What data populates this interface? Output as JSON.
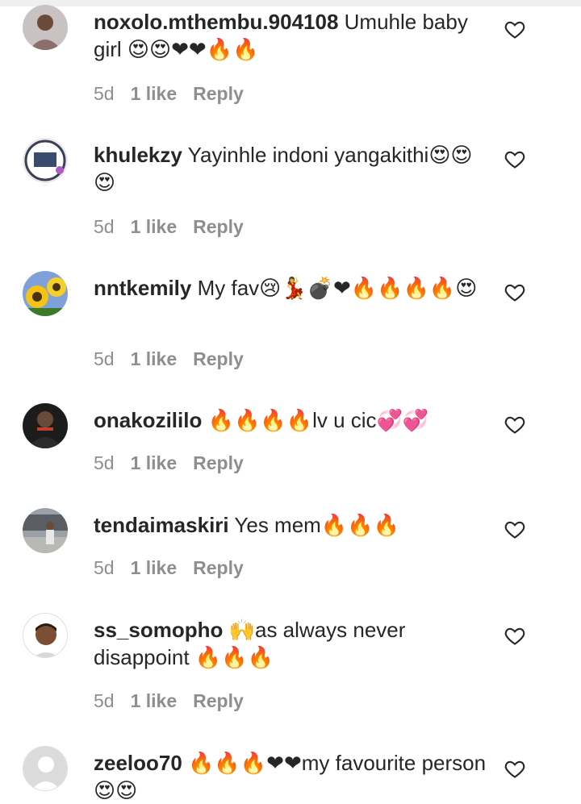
{
  "colors": {
    "text": "#262626",
    "meta": "#8e8e8e"
  },
  "comments": [
    {
      "username": "noxolo.mthembu.904108",
      "text": "Umuhle baby girl 😍😍❤❤🔥🔥",
      "age": "5d",
      "likes": "1 like",
      "reply": "Reply",
      "avatar": "woman-avatar",
      "like_icon": "heart-outline-icon"
    },
    {
      "username": "khulekzy",
      "text": "Yayinhle indoni yangakithi😍😍😍",
      "age": "5d",
      "likes": "1 like",
      "reply": "Reply",
      "avatar": "badge-avatar",
      "like_icon": "heart-outline-icon"
    },
    {
      "username": "nntkemily",
      "text": "My fav😢💃💣❤🔥🔥🔥🔥😍",
      "age": "5d",
      "likes": "1 like",
      "reply": "Reply",
      "avatar": "sunflower-avatar",
      "like_icon": "heart-outline-icon"
    },
    {
      "username": "onakozililo",
      "text": "🔥🔥🔥🔥lv u cic💞💞",
      "age": "5d",
      "likes": "1 like",
      "reply": "Reply",
      "avatar": "man-dark-avatar",
      "like_icon": "heart-outline-icon"
    },
    {
      "username": "tendaimaskiri",
      "text": "Yes mem🔥🔥🔥",
      "age": "5d",
      "likes": "1 like",
      "reply": "Reply",
      "avatar": "street-avatar",
      "like_icon": "heart-outline-icon"
    },
    {
      "username": "ss_somopho",
      "text": "🙌as always never disappoint 🔥🔥🔥",
      "age": "5d",
      "likes": "1 like",
      "reply": "Reply",
      "avatar": "emoji-man-avatar",
      "like_icon": "heart-outline-icon"
    },
    {
      "username": "zeeloo70",
      "text": "🔥🔥🔥❤❤my favourite person😍😍",
      "age": "",
      "likes": "",
      "reply": "",
      "avatar": "default-avatar",
      "like_icon": "heart-outline-icon"
    }
  ]
}
